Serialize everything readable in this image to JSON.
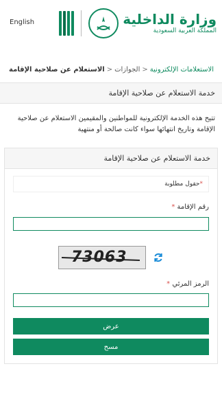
{
  "header": {
    "language_link": "English",
    "logo_title": "وزارة الداخلية",
    "logo_subtitle": "المملكة العربية السعودية"
  },
  "breadcrumb": {
    "items": [
      "الاستعلامات الإلكترونية",
      "الجوازات",
      "الاستعلام عن صلاحية الإقامة"
    ]
  },
  "service": {
    "title": "خدمة الاستعلام عن صلاحية الإقامة",
    "description": "تتيح هذه الخدمة الإلكترونية للمواطنين والمقيمين الاستعلام عن صلاحية الإقامة وتاريخ انتهائها سواء كانت صالحة أو منتهية"
  },
  "form": {
    "panel_title": "خدمة الاستعلام عن صلاحية الإقامة",
    "required_note": "حقول مطلوبة",
    "iqama_label": "رقم الإقامة",
    "iqama_value": "",
    "captcha_text": "73063",
    "captcha_label": "الرمز المرئي",
    "captcha_value": "",
    "submit_label": "عرض",
    "clear_label": "مسح"
  },
  "colors": {
    "brand_green": "#0f8a5f",
    "required": "#d9534f",
    "refresh_blue": "#1a8cd8"
  },
  "icons": {
    "refresh": "refresh-icon",
    "emblem": "saudi-emblem-icon"
  }
}
